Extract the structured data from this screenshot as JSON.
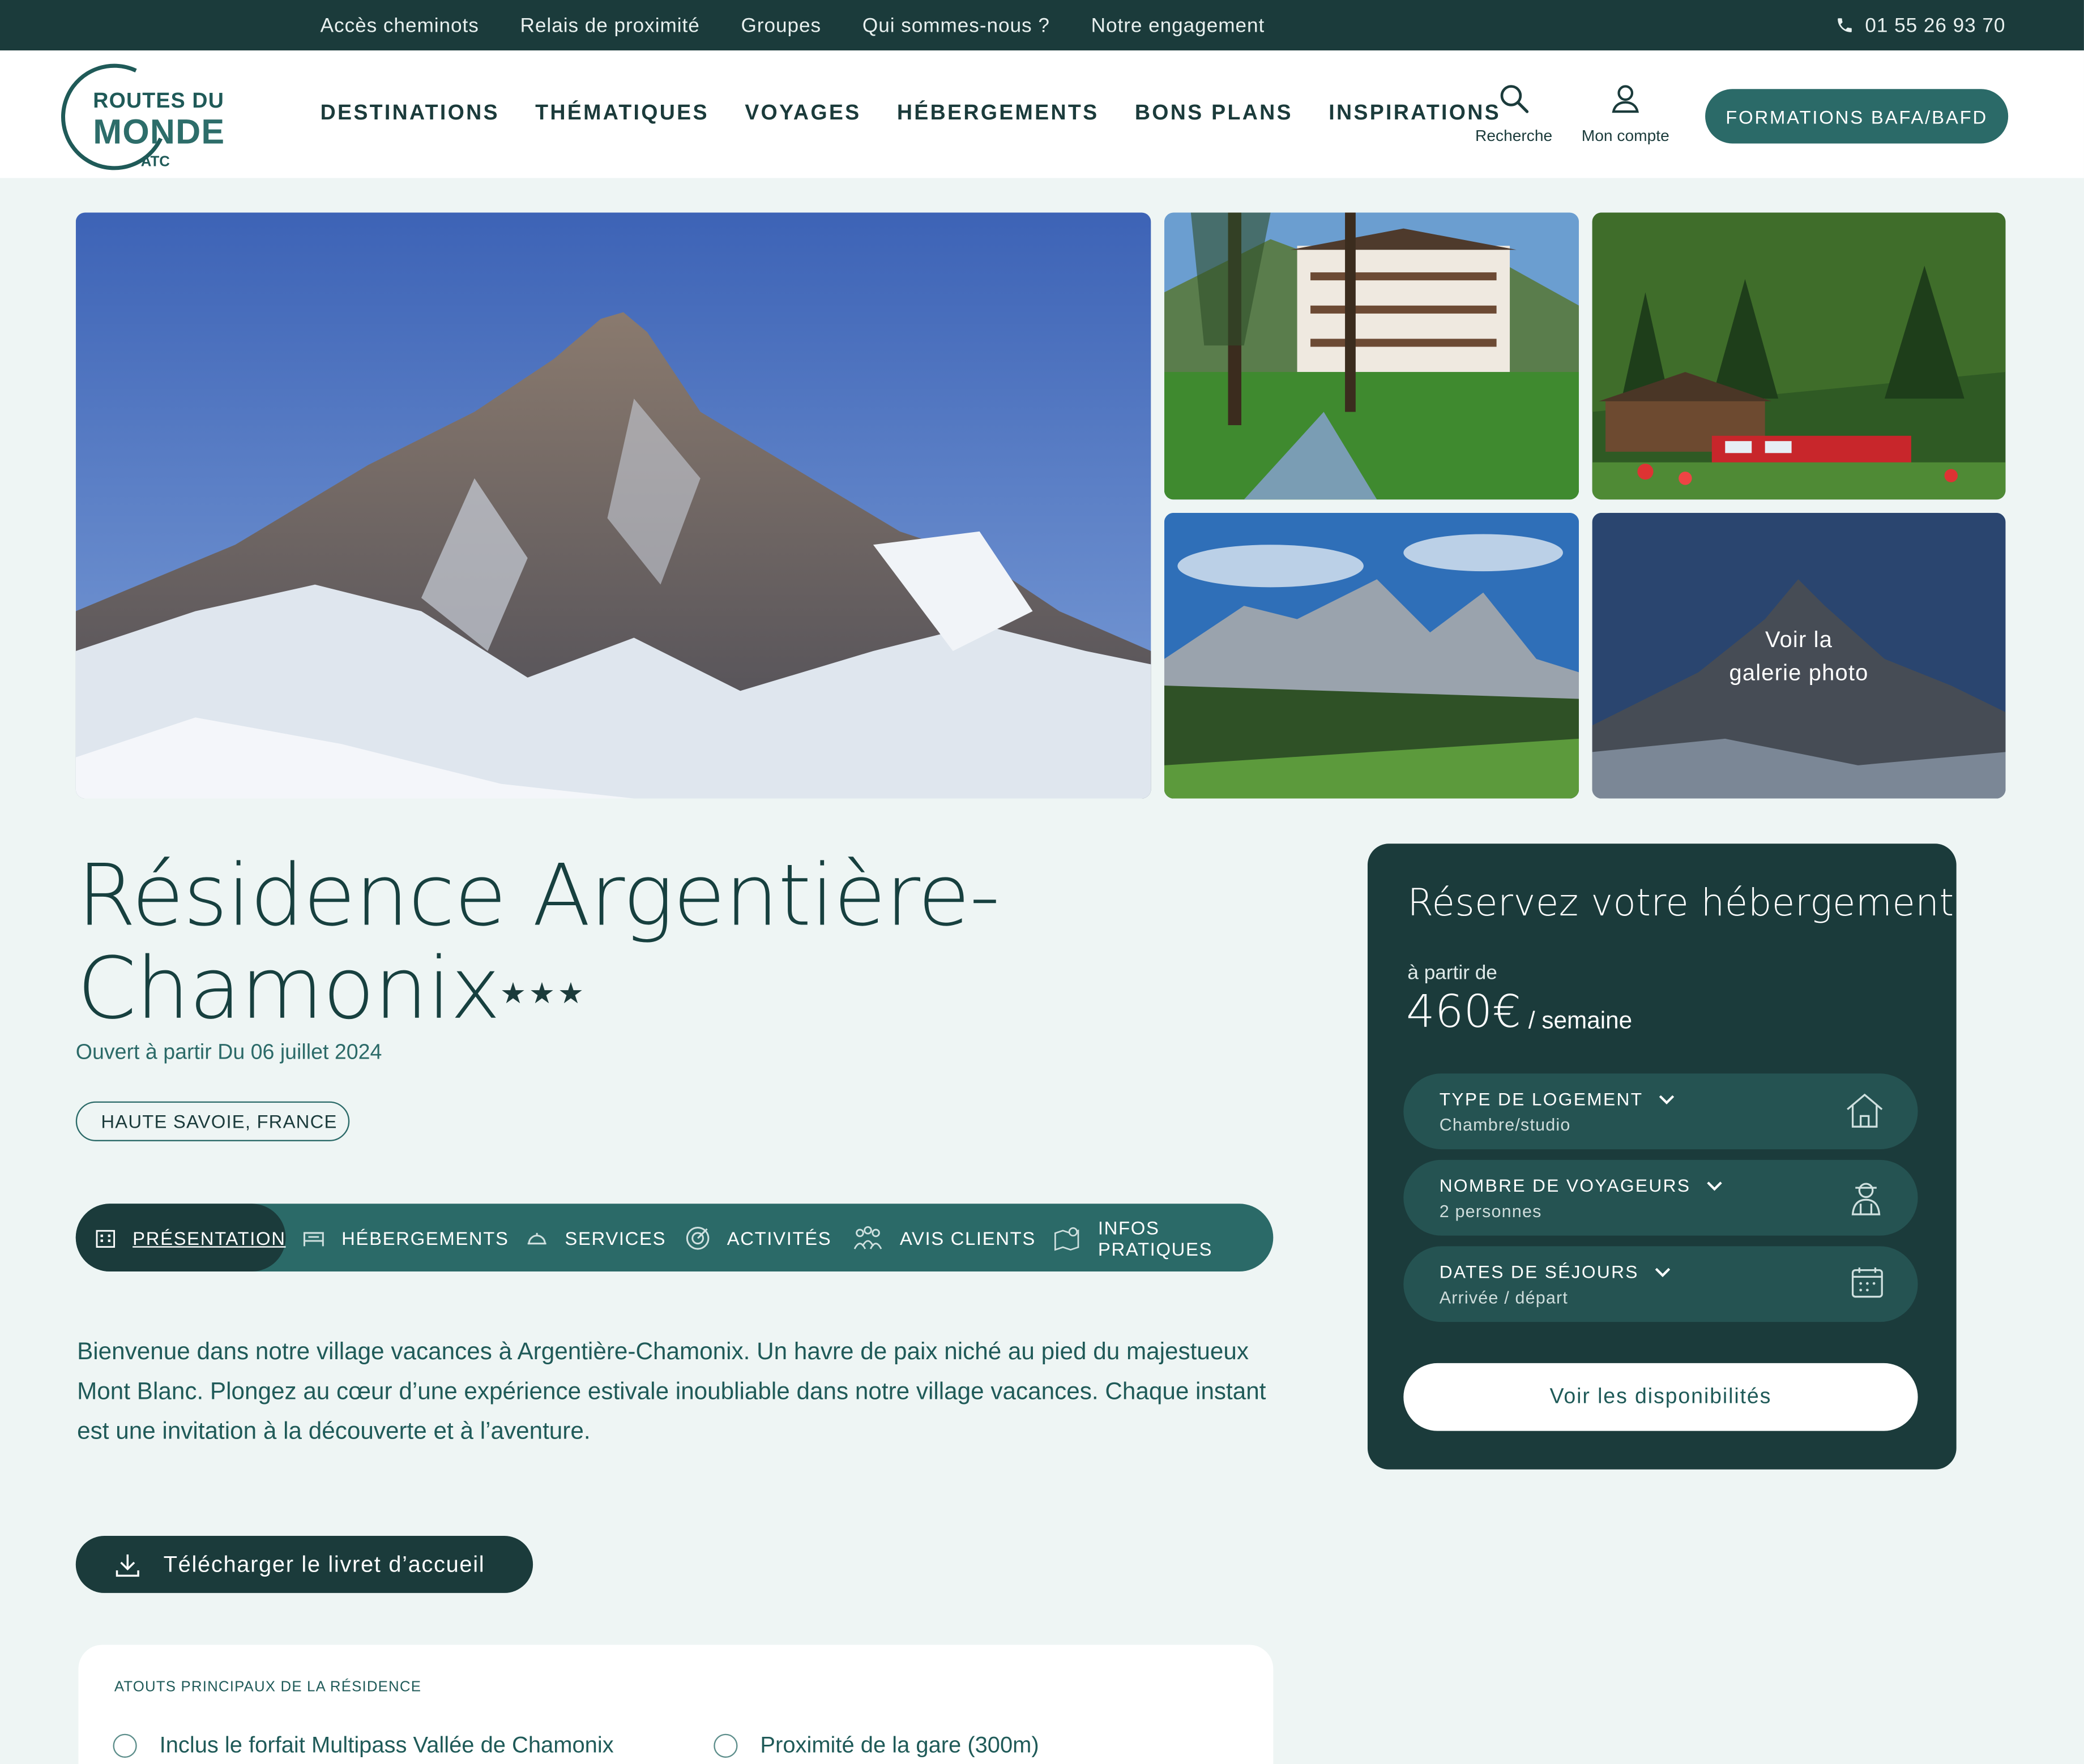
{
  "topbar": {
    "links": [
      "Accès cheminots",
      "Relais de proximité",
      "Groupes",
      "Qui sommes-nous ?",
      "Notre engagement"
    ],
    "phone": "01 55 26 93 70"
  },
  "logo": {
    "line1": "ROUTES DU",
    "line2": "MONDE",
    "line3": "ATC"
  },
  "nav": [
    "DESTINATIONS",
    "THÉMATIQUES",
    "VOYAGES",
    "HÉBERGEMENTS",
    "BONS PLANS",
    "INSPIRATIONS"
  ],
  "header": {
    "search_label": "Recherche",
    "account_label": "Mon compte",
    "cta_label": "FORMATIONS BAFA/BAFD"
  },
  "gallery": {
    "overlay_line1": "Voir la",
    "overlay_line2": "galerie photo"
  },
  "residence": {
    "title_line1": "Résidence Argentière-",
    "title_line2": "Chamonix",
    "stars": "★★★",
    "opening": "Ouvert à partir Du 06 juillet 2024",
    "region": "HAUTE SAVOIE, FRANCE"
  },
  "tabs": [
    "PRÉSENTATION",
    "HÉBERGEMENTS",
    "SERVICES",
    "ACTIVITÉS",
    "AVIS CLIENTS",
    "INFOS PRATIQUES"
  ],
  "intro": "Bienvenue dans notre village vacances à Argentière-Chamonix. Un havre de paix niché au pied du majestueux Mont Blanc. Plongez au cœur d’une expérience estivale inoubliable dans notre village vacances. Chaque instant est une invitation à la découverte et à l’aventure.",
  "download_label": "Télécharger le livret d’accueil",
  "atouts": {
    "heading": "ATOUTS PRINCIPAUX DE LA RÉSIDENCE",
    "items": [
      "Inclus le forfait Multipass Vallée de Chamonix",
      "Proximité de la gare (300m)"
    ]
  },
  "booking": {
    "title": "Réservez votre hébergement",
    "from_label": "à partir de",
    "price": "460€",
    "unit": "/ semaine",
    "fields": [
      {
        "label": "TYPE DE LOGEMENT",
        "value": "Chambre/studio",
        "icon": "house-icon"
      },
      {
        "label": "NOMBRE DE VOYAGEURS",
        "value": "2 personnes",
        "icon": "traveler-icon"
      },
      {
        "label": "DATES DE SÉJOURS",
        "value": "Arrivée / départ",
        "icon": "calendar-icon"
      }
    ],
    "cta": "Voir les disponibilités"
  },
  "colors": {
    "dark": "#1b3b3b",
    "accent": "#2b6a68",
    "background": "#eef5f4"
  }
}
